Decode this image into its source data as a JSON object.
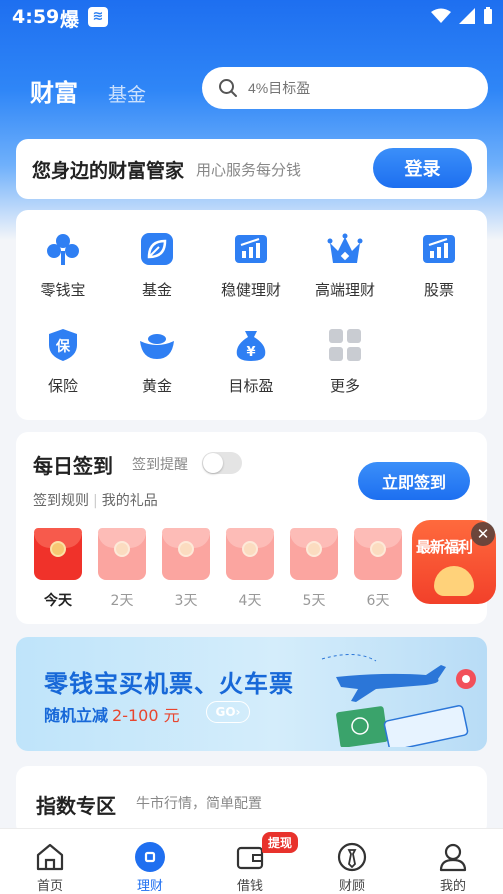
{
  "status_bar": {
    "time": "4:59",
    "fire_glyph": "爆"
  },
  "header": {
    "tab_active": "财富",
    "tab_inactive": "基金",
    "search_placeholder": "4%目标盈"
  },
  "welcome": {
    "title": "您身边的财富管家",
    "subtitle": "用心服务每分钱",
    "login_label": "登录"
  },
  "grid": {
    "items": [
      {
        "label": "零钱宝",
        "icon": "clover-icon"
      },
      {
        "label": "基金",
        "icon": "leaf-icon"
      },
      {
        "label": "稳健理财",
        "icon": "bar-chart-icon"
      },
      {
        "label": "高端理财",
        "icon": "crown-icon"
      },
      {
        "label": "股票",
        "icon": "stock-chart-icon"
      },
      {
        "label": "保险",
        "icon": "shield-icon"
      },
      {
        "label": "黄金",
        "icon": "gold-ingot-icon"
      },
      {
        "label": "目标盈",
        "icon": "money-bag-icon"
      },
      {
        "label": "更多",
        "icon": "grid-more-icon"
      }
    ]
  },
  "signin": {
    "title": "每日签到",
    "remind_label": "签到提醒",
    "rules_label": "签到规则",
    "gifts_label": "我的礼品",
    "button_label": "立即签到",
    "days": [
      "今天",
      "2天",
      "3天",
      "4天",
      "5天",
      "6天"
    ]
  },
  "promo_float": {
    "text": "最新福利"
  },
  "banner": {
    "title": "零钱宝买机票、火车票",
    "subtitle": "随机立减",
    "amount": "2-100 元",
    "go_label": "GO›"
  },
  "index_zone": {
    "title": "指数专区",
    "subtitle": "牛市行情，简单配置"
  },
  "nav": {
    "items": [
      {
        "label": "首页",
        "icon": "home-icon"
      },
      {
        "label": "理财",
        "icon": "wealth-icon"
      },
      {
        "label": "借钱",
        "icon": "wallet-icon"
      },
      {
        "label": "财顾",
        "icon": "advisor-icon"
      },
      {
        "label": "我的",
        "icon": "user-icon"
      }
    ],
    "badge": "提现"
  },
  "colors": {
    "brand_blue": "#1f6ff0",
    "red": "#e8322c"
  }
}
